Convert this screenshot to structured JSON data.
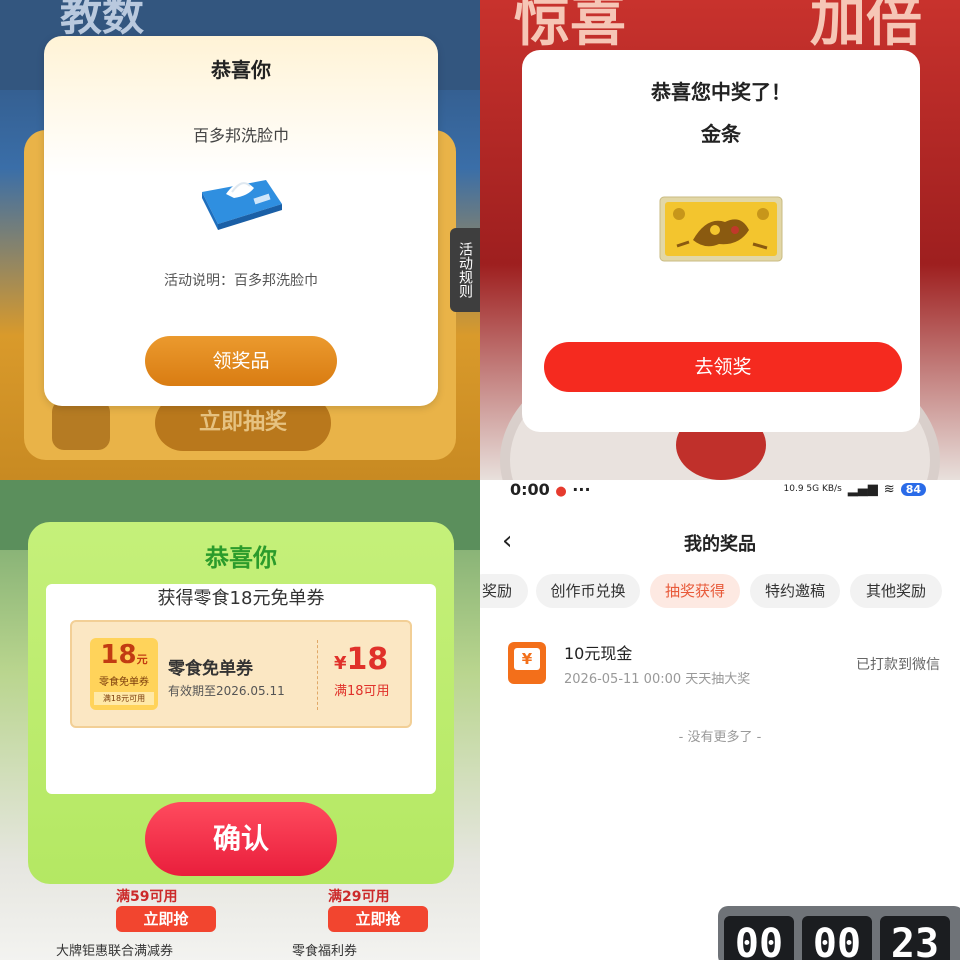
{
  "q1": {
    "bg_top_text": "教数",
    "bg_action_label": "立即抽奖",
    "side_rules": "活动规则",
    "title": "恭喜你",
    "prize_name": "百多邦洗脸巾",
    "description": "活动说明：百多邦洗脸巾",
    "claim_button": "领奖品",
    "icons": {
      "wipes": "face-towel-pack-icon",
      "gift": "gift-icon"
    }
  },
  "q2": {
    "bg_text_left": "惊喜",
    "bg_text_right": "加倍",
    "title": "恭喜您中奖了！",
    "prize_name": "金条",
    "claim_button": "去领奖",
    "icons": {
      "prize": "gold-bar-icon"
    }
  },
  "q3": {
    "title": "恭喜你",
    "subtitle": "获得零食18元免单券",
    "coupon": {
      "badge_amount": "18",
      "badge_unit": "元",
      "badge_label": "零食免单券",
      "badge_condition": "满18元可用",
      "name": "零食免单券",
      "validity": "有效期至2026.05.11",
      "currency": "¥",
      "amount": "18",
      "condition": "满18可用"
    },
    "confirm_button": "确认",
    "bg_cards": [
      {
        "label": "满59可用",
        "button": "立即抢",
        "name": "大牌钜惠联合满减券"
      },
      {
        "label": "满29可用",
        "button": "立即抢",
        "name": "零食福利券"
      }
    ]
  },
  "q4": {
    "status_time": "0:00",
    "status_dots": "···",
    "network": "10.9 5G KB/s",
    "battery": "84",
    "page_title": "我的奖品",
    "back_icon": "back-arrow-icon",
    "tabs": [
      {
        "label": "奖励",
        "active": false
      },
      {
        "label": "创作币兑换",
        "active": false
      },
      {
        "label": "抽奖获得",
        "active": true
      },
      {
        "label": "特约邀稿",
        "active": false
      },
      {
        "label": "其他奖励",
        "active": false
      }
    ],
    "record": {
      "name": "10元现金",
      "detail": "2026-05-11 00:00 天天抽大奖",
      "status": "已打款到微信",
      "icon": "cash-icon",
      "icon_glyph": "¥"
    },
    "no_more": "- 没有更多了 -",
    "timer": [
      "00",
      "00",
      "23"
    ]
  },
  "colors": {
    "q1_claim": "#df8419",
    "q2_claim": "#f52a1f",
    "q3_confirm": "#ef2844",
    "q3_title": "#2b9b2b",
    "q4_active_tab": "#e85a3a",
    "q4_record_icon": "#f36f1a"
  }
}
